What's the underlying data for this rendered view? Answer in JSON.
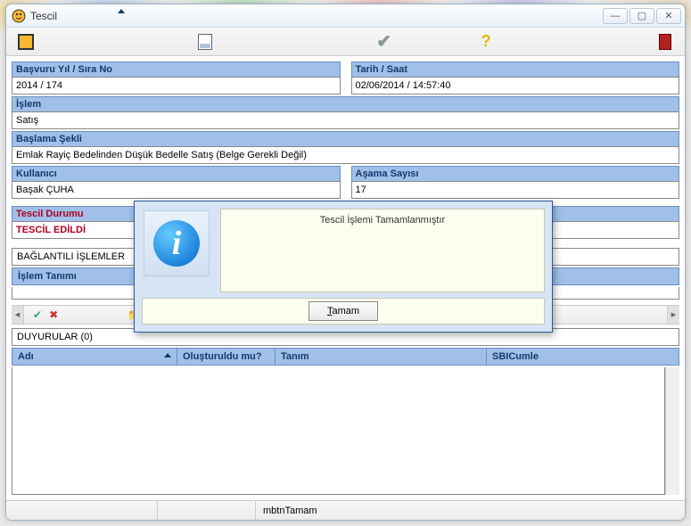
{
  "window": {
    "title": "Tescil"
  },
  "toolbar": {
    "icons": {
      "sun": "sun-icon",
      "doc": "document-icon",
      "check": "check-icon",
      "help": "help-icon",
      "close": "close-red-icon"
    }
  },
  "fields": {
    "basvuru": {
      "label": "Başvuru Yıl / Sıra No",
      "value": "2014 / 174"
    },
    "tarih": {
      "label": "Tarih / Saat",
      "value": "02/06/2014 / 14:57:40"
    },
    "islem": {
      "label": "İşlem",
      "value": "Satış"
    },
    "baslama": {
      "label": "Başlama Şekli",
      "value": "Emlak Rayiç Bedelinden Düşük Bedelle Satış (Belge Gerekli Değil)"
    },
    "kullanici": {
      "label": "Kullanıcı",
      "value": "Başak ÇUHA"
    },
    "asama": {
      "label": "Aşama Sayısı",
      "value": "17"
    },
    "tescil_durumu": {
      "label": "Tescil Durumu",
      "value": "TESCİL EDİLDİ"
    }
  },
  "linked": {
    "header": "BAĞLANTILI İŞLEMLER",
    "cols": {
      "islem_tanimi": "İşlem Tanımı"
    }
  },
  "announcements": {
    "header": "DUYURULAR (0)",
    "cols": {
      "adi": "Adı",
      "olusturuldu": "Oluşturuldu mu?",
      "tanim": "Tanım",
      "sbi": "SBICumle"
    },
    "rows": []
  },
  "modal": {
    "message": "Tescil İşlemi Tamamlanmıştır",
    "button": "Tamam",
    "button_accel": "T"
  },
  "statusbar": {
    "hint": "mbtnTamam"
  }
}
